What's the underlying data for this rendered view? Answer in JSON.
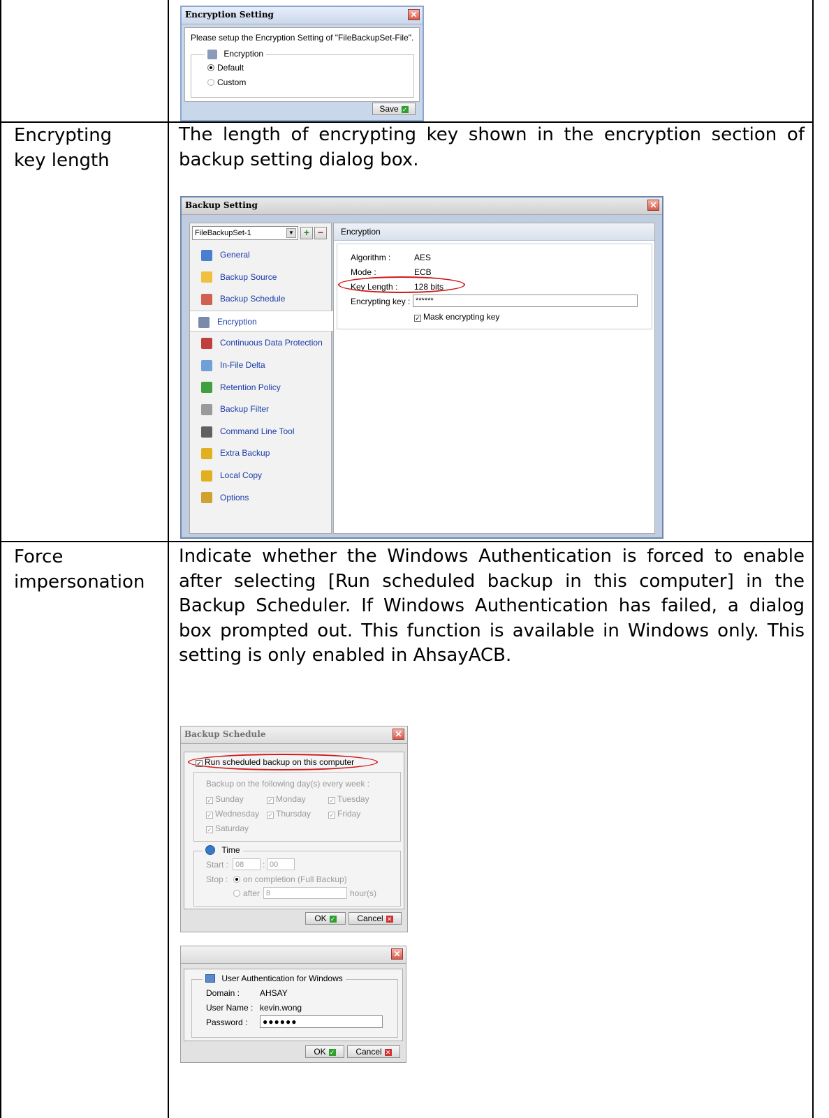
{
  "rows": [
    {
      "label_line1": "",
      "label_line2": ""
    },
    {
      "label_line1": "Encrypting",
      "label_line2": "key length",
      "description": "The length of encrypting key shown in the encryption section of backup setting dialog box."
    },
    {
      "label_line1": "Force",
      "label_line2": "impersonation",
      "description": "Indicate whether the Windows Authentication is forced to enable after selecting [Run scheduled backup in this computer] in the Backup Scheduler. If Windows Authentication has failed, a dialog box prompted out. This function is available in Windows only. This setting is only enabled in AhsayACB."
    }
  ],
  "encryption_dialog": {
    "title": "Encryption Setting",
    "close": "✕",
    "message": "Please setup the Encryption Setting of \"FileBackupSet-File\".",
    "group_label": "Encryption",
    "option_default": "Default",
    "option_custom": "Custom",
    "selected": "Default",
    "save_label": "Save"
  },
  "backup_setting": {
    "title": "Backup Setting",
    "close": "✕",
    "set_selector": "FileBackupSet-1",
    "add": "+",
    "remove": "−",
    "nav": [
      {
        "label": "General",
        "icon": "general-icon",
        "color": "#4a7fd0"
      },
      {
        "label": "Backup Source",
        "icon": "folder-icon",
        "color": "#f0c040"
      },
      {
        "label": "Backup Schedule",
        "icon": "schedule-icon",
        "color": "#d06050"
      },
      {
        "label": "Encryption",
        "icon": "encryption-icon",
        "color": "#7a8aa8"
      },
      {
        "label": "Continuous Data Protection",
        "icon": "cdp-icon",
        "color": "#c04040"
      },
      {
        "label": "In-File Delta",
        "icon": "delta-icon",
        "color": "#6fa0d8"
      },
      {
        "label": "Retention Policy",
        "icon": "recycle-icon",
        "color": "#40a040"
      },
      {
        "label": "Backup Filter",
        "icon": "filter-icon",
        "color": "#9a9a9a"
      },
      {
        "label": "Command Line Tool",
        "icon": "terminal-icon",
        "color": "#606060"
      },
      {
        "label": "Extra Backup",
        "icon": "extra-backup-icon",
        "color": "#e0b020"
      },
      {
        "label": "Local Copy",
        "icon": "local-copy-icon",
        "color": "#e0b020"
      },
      {
        "label": "Options",
        "icon": "options-icon",
        "color": "#d0a030"
      }
    ],
    "selected_nav": "Encryption",
    "section_title": "Encryption",
    "algorithm_label": "Algorithm :",
    "algorithm_value": "AES",
    "mode_label": "Mode :",
    "mode_value": "ECB",
    "key_length_label": "Key Length :",
    "key_length_value": "128 bits",
    "encrypting_key_label": "Encrypting key :",
    "encrypting_key_value": "******",
    "mask_label": "Mask encrypting key",
    "mask_checked": true
  },
  "backup_schedule": {
    "title": "Backup Schedule",
    "close": "✕",
    "run_label": "Run scheduled backup on this computer",
    "run_checked": true,
    "days_heading": "Backup on the following day(s) every week :",
    "days": [
      "Sunday",
      "Monday",
      "Tuesday",
      "Wednesday",
      "Thursday",
      "Friday",
      "Saturday"
    ],
    "time_label": "Time",
    "start_label": "Start :",
    "start_hour": "08",
    "start_min": "00",
    "time_sep": ":",
    "stop_label": "Stop :",
    "stop_completion": "on completion (Full Backup)",
    "stop_after": "after",
    "after_value": "8",
    "hours_label": "hour(s)",
    "ok_label": "OK",
    "cancel_label": "Cancel"
  },
  "auth_dialog": {
    "close": "✕",
    "group_label": "User Authentication for Windows",
    "domain_label": "Domain :",
    "domain_value": "AHSAY",
    "user_label": "User Name :",
    "user_value": "kevin.wong",
    "password_label": "Password :",
    "password_value": "●●●●●●",
    "ok_label": "OK",
    "cancel_label": "Cancel"
  }
}
